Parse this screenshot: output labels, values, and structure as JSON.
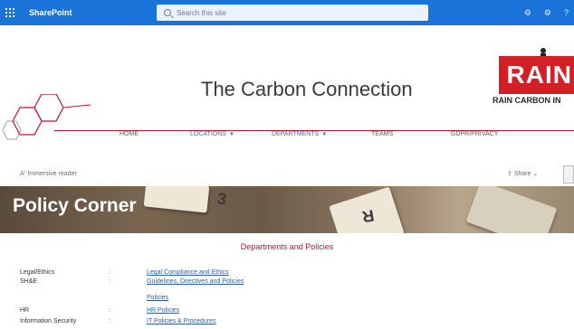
{
  "suitebar": {
    "app_name": "SharePoint",
    "search_placeholder": "Search this site",
    "icons": [
      "settings-icon",
      "gear-icon",
      "help-icon"
    ],
    "icon_glyphs": [
      "⚙",
      "⚙",
      "?"
    ],
    "accent": "#1a73d8"
  },
  "header": {
    "site_title": "The Carbon Connection",
    "logo_text": "RAIN",
    "logo_subtext": "RAIN CARBON IN",
    "brand_color": "#c8102e"
  },
  "nav": {
    "items": [
      {
        "label": "HOME",
        "dropdown": false
      },
      {
        "label": "LOCATIONS",
        "dropdown": true
      },
      {
        "label": "DEPARTMENTS",
        "dropdown": true
      },
      {
        "label": "TEAMS",
        "dropdown": false
      },
      {
        "label": "GDPR/PRIVACY",
        "dropdown": false
      }
    ]
  },
  "commandbar": {
    "immersive_reader": "Immersive reader",
    "share": "Share"
  },
  "banner": {
    "title": "Policy Corner"
  },
  "content": {
    "section_title": "Departments and Policies",
    "rows": [
      {
        "dept": "Legal/Ethics",
        "sep": ":",
        "doc": "Legal Compliance and Ethics"
      },
      {
        "dept": "SH&E",
        "sep": ":",
        "doc": "Guidelines, Directives and Policies"
      },
      {
        "dept": "",
        "sep": "",
        "doc": "Policies"
      },
      {
        "dept": "HR",
        "sep": ":",
        "doc": "HR Policies"
      },
      {
        "dept": "Information Security",
        "sep": ":",
        "doc": "IT Policies & Procedures"
      }
    ]
  }
}
